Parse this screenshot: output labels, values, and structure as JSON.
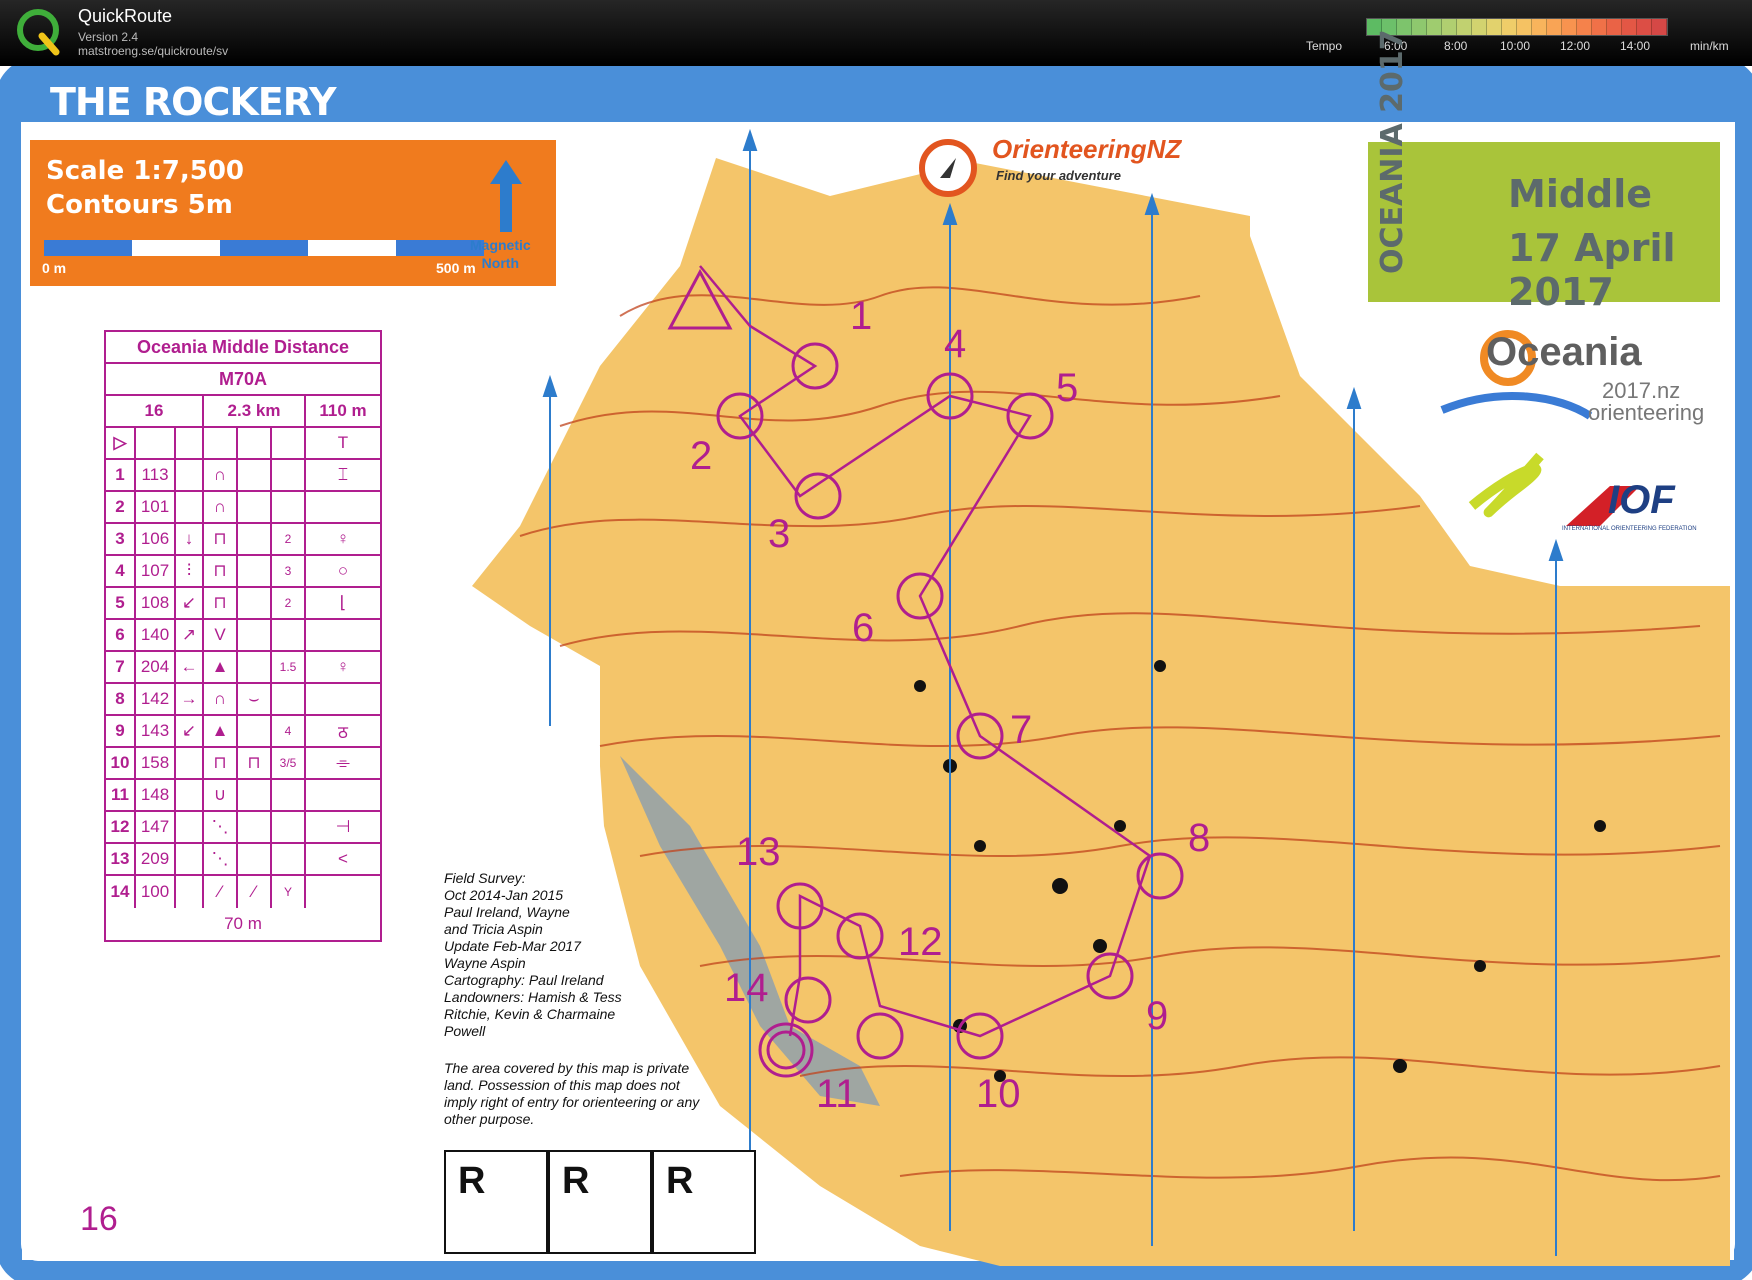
{
  "app": {
    "name": "QuickRoute",
    "version": "Version 2.4",
    "url": "matstroeng.se/quickroute/sv"
  },
  "tempo": {
    "label": "Tempo",
    "ticks": [
      "6:00",
      "8:00",
      "10:00",
      "12:00",
      "14:00"
    ],
    "unit": "min/km",
    "colors": [
      "#5dbb63",
      "#6cc06a",
      "#7dc46c",
      "#8ec86e",
      "#9fcc6f",
      "#b0cf70",
      "#c1d170",
      "#d2d36f",
      "#e2d26d",
      "#efcd69",
      "#f5c263",
      "#f8b45c",
      "#f9a455",
      "#f8934f",
      "#f5824b",
      "#f07148",
      "#ea6346",
      "#e35745",
      "#dc4e45",
      "#d54846"
    ]
  },
  "map": {
    "title": "THE ROCKERY",
    "scale": "Scale 1:7,500",
    "contours": "Contours 5m",
    "scale_start": "0 m",
    "scale_end": "500 m",
    "magnetic_north": [
      "Magnetic",
      "North"
    ],
    "event_region": "OCEANIA",
    "event_year": "2017",
    "event_type": "Middle",
    "event_date": "17 April 2017",
    "onz_name": "OrienteeringNZ",
    "onz_tagline": "Find your adventure",
    "oceania_word": "Oceania",
    "oceania_year": "2017.nz",
    "oceania_sub": "orienteering",
    "iof_logo": "IOF",
    "iof_text": "INTERNATIONAL ORIENTEERING FEDERATION",
    "course_number": "16",
    "survey_lines": [
      "Field Survey:",
      "Oct 2014-Jan 2015",
      "Paul Ireland, Wayne",
      "and Tricia Aspin",
      "Update Feb-Mar 2017",
      "Wayne Aspin",
      "Cartography: Paul Ireland",
      "Landowners: Hamish & Tess",
      "Ritchie, Kevin & Charmaine",
      "Powell"
    ],
    "private_note": "The area covered by this map is private land. Possession of this map does not imply right of entry for orienteering or any other purpose.",
    "r_boxes": [
      "R",
      "R",
      "R"
    ],
    "colors": {
      "terrain": "#f4c56a",
      "contour": "#c0431c",
      "course": "#b01e8f",
      "border": "#4a8fd9",
      "water": "#5a8ccf"
    }
  },
  "descriptions": {
    "event": "Oceania Middle Distance",
    "class": "M70A",
    "course_no": "16",
    "length": "2.3 km",
    "climb": "110 m",
    "start_symbols": [
      "▷",
      "",
      "",
      "",
      "",
      "",
      "T"
    ],
    "controls": [
      {
        "n": "1",
        "code": "113",
        "c": "",
        "d": "∩",
        "e": "",
        "f": "",
        "g": "",
        "h": "⌶"
      },
      {
        "n": "2",
        "code": "101",
        "c": "",
        "d": "∩",
        "e": "",
        "f": "",
        "g": "",
        "h": ""
      },
      {
        "n": "3",
        "code": "106",
        "c": "↓",
        "d": "⊓",
        "e": "",
        "f": "2",
        "g": "",
        "h": "♀"
      },
      {
        "n": "4",
        "code": "107",
        "c": "⫶",
        "d": "⊓",
        "e": "",
        "f": "3",
        "g": "",
        "h": "○"
      },
      {
        "n": "5",
        "code": "108",
        "c": "↙",
        "d": "⊓",
        "e": "",
        "f": "2",
        "g": "",
        "h": "⌊"
      },
      {
        "n": "6",
        "code": "140",
        "c": "↗",
        "d": "V",
        "e": "",
        "f": "",
        "g": "",
        "h": ""
      },
      {
        "n": "7",
        "code": "204",
        "c": "←",
        "d": "▲",
        "e": "",
        "f": "1.5",
        "g": "",
        "h": "♀"
      },
      {
        "n": "8",
        "code": "142",
        "c": "→",
        "d": "∩",
        "e": "⌣",
        "f": "",
        "g": "",
        "h": ""
      },
      {
        "n": "9",
        "code": "143",
        "c": "↙",
        "d": "▲",
        "e": "",
        "f": "4",
        "g": "",
        "h": "ठ"
      },
      {
        "n": "10",
        "code": "158",
        "c": "",
        "d": "⊓",
        "e": "⊓",
        "f": "3/5",
        "g": "",
        "h": "⌯"
      },
      {
        "n": "11",
        "code": "148",
        "c": "",
        "d": "∪",
        "e": "",
        "f": "",
        "g": "",
        "h": ""
      },
      {
        "n": "12",
        "code": "147",
        "c": "",
        "d": "⋱",
        "e": "",
        "f": "",
        "g": "",
        "h": "⊣"
      },
      {
        "n": "13",
        "code": "209",
        "c": "",
        "d": "⋱",
        "e": "",
        "f": "",
        "g": "",
        "h": "<"
      },
      {
        "n": "14",
        "code": "100",
        "c": "",
        "d": "⁄",
        "e": "⁄",
        "f": "Y",
        "g": "",
        "h": ""
      }
    ],
    "finish": "70 m"
  },
  "control_labels": [
    "1",
    "2",
    "3",
    "4",
    "5",
    "6",
    "7",
    "8",
    "9",
    "10",
    "11",
    "12",
    "13",
    "14"
  ]
}
